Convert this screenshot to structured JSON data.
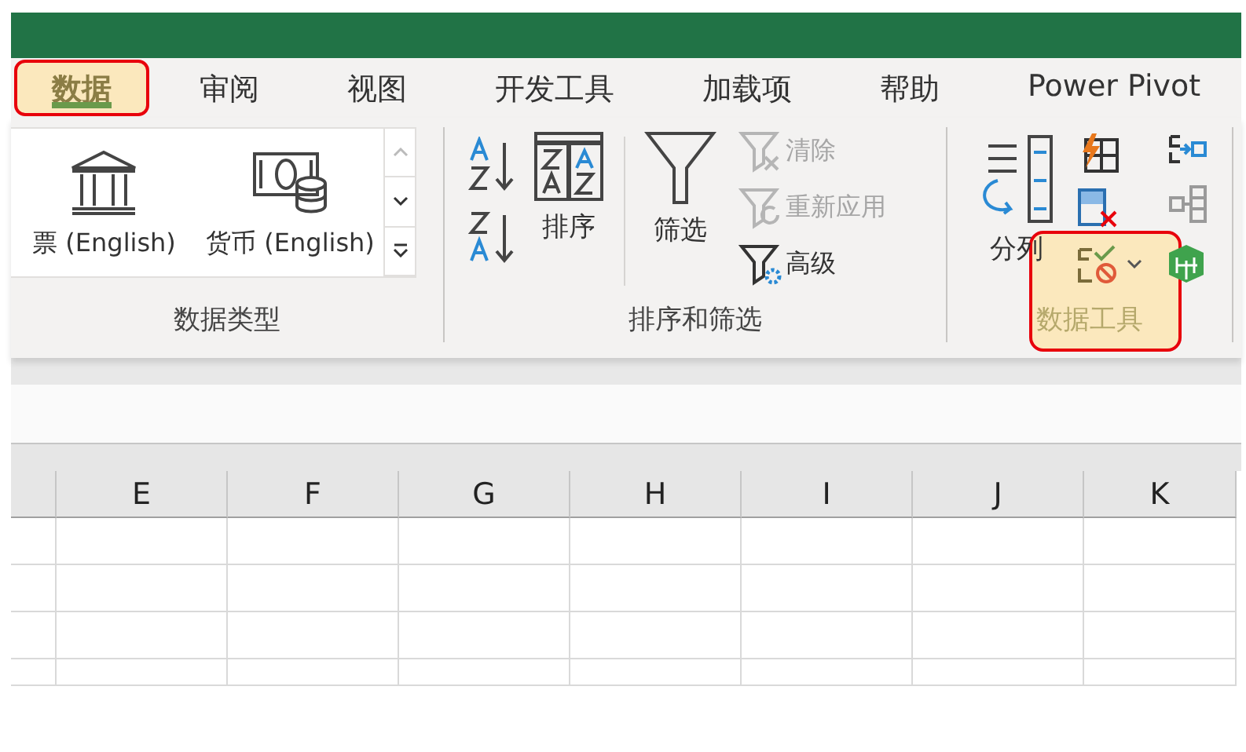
{
  "tabs": [
    {
      "label": "数据",
      "selected": true,
      "highlighted": true
    },
    {
      "label": "审阅",
      "selected": false,
      "highlighted": false
    },
    {
      "label": "视图",
      "selected": false,
      "highlighted": false
    },
    {
      "label": "开发工具",
      "selected": false,
      "highlighted": false
    },
    {
      "label": "加载项",
      "selected": false,
      "highlighted": false
    },
    {
      "label": "帮助",
      "selected": false,
      "highlighted": false
    },
    {
      "label": "Power Pivot",
      "selected": false,
      "highlighted": false
    }
  ],
  "ribbon": {
    "groups": [
      {
        "kind": "data_types",
        "label": "数据类型",
        "items": [
          {
            "label": "票 (English)"
          },
          {
            "label": "货币 (English)"
          }
        ]
      },
      {
        "kind": "sort_filter",
        "label": "排序和筛选",
        "sort_button": "排序",
        "filter_button": "筛选",
        "filter_actions": [
          {
            "label": "清除",
            "disabled": true
          },
          {
            "label": "重新应用",
            "disabled": true
          },
          {
            "label": "高级",
            "disabled": false
          }
        ]
      },
      {
        "kind": "data_tools",
        "label": "数据工具",
        "highlighted": true,
        "split_button": "分列"
      }
    ]
  },
  "sheet": {
    "columns": [
      "E",
      "F",
      "G",
      "H",
      "I",
      "J",
      "K"
    ]
  }
}
